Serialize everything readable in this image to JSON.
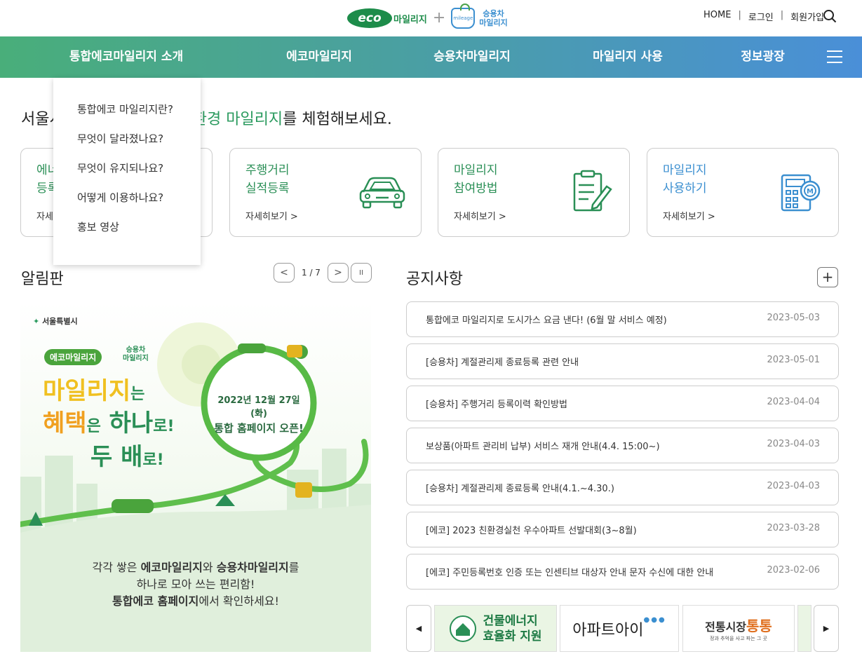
{
  "header": {
    "logo_eco": "eco",
    "logo_eco_suffix": "마일리지",
    "logo_plus": "+",
    "logo_bag_text": "mileage",
    "logo_car_line1": "승용차",
    "logo_car_line2": "마일리지",
    "links": [
      "HOME",
      "로그인",
      "회원가입"
    ],
    "separator": "|"
  },
  "nav": {
    "items": [
      "통합에코마일리지 소개",
      "에코마일리지",
      "승용차마일리지",
      "마일리지 사용",
      "정보광장"
    ]
  },
  "dropdown": {
    "items": [
      "통합에코 마일리지란?",
      "무엇이 달라졌나요?",
      "무엇이 유지되나요?",
      "어떻게 이용하나요?",
      "홍보 영상"
    ]
  },
  "headline": {
    "prefix": "서울시",
    "green": "환경 마일리지",
    "suffix": "를 체험해보세요."
  },
  "cards": [
    {
      "title": "에너지\n등록",
      "more": "자세히보기 >",
      "icon": "register-icon"
    },
    {
      "title": "주행거리\n실적등록",
      "more": "자세히보기 >",
      "icon": "car-icon"
    },
    {
      "title": "마일리지\n참여방법",
      "more": "자세히보기 >",
      "icon": "clipboard-icon"
    },
    {
      "title": "마일리지\n사용하기",
      "more": "자세히보기 >",
      "icon": "calculator-icon"
    }
  ],
  "board": {
    "title": "알림판",
    "page": "1 / 7",
    "prev": "<",
    "next": ">",
    "pause": "II"
  },
  "banner": {
    "city": "서울특별시",
    "eco_logo": "에코마일리지",
    "car_logo_line1": "승용차",
    "car_logo_line2": "마일리지",
    "line1a": "마일리지",
    "line1b": "는",
    "line2a": "혜택",
    "line2b": "은",
    "line2c": "하나",
    "line2d": "로!",
    "line3a": "두 배",
    "line3b": "로!",
    "date": "2022년 12월 27일(화)",
    "dash": "—",
    "open": "통합 홈페이지 오픈!",
    "bottom1a": "각각 쌓은 ",
    "bottom1b": "에코마일리지",
    "bottom1c": "와 ",
    "bottom1d": "승용차마일리지",
    "bottom1e": "를",
    "bottom2": "하나로 모아 쓰는 편리함!",
    "bottom3a": "통합에코 홈페이지",
    "bottom3b": "에서 확인하세요!"
  },
  "notices": {
    "title": "공지사항",
    "more": "+",
    "items": [
      {
        "title": "통합에코 마일리지로 도시가스 요금 낸다! (6월 말 서비스 예정)",
        "date": "2023-05-03"
      },
      {
        "title": "[승용차] 계절관리제 종료등록 관련 안내",
        "date": "2023-05-01"
      },
      {
        "title": "[승용차] 주행거리 등록이력 확인방법",
        "date": "2023-04-04"
      },
      {
        "title": "보상품(아파트 관리비 납부) 서비스 재개 안내(4.4. 15:00~)",
        "date": "2023-04-03"
      },
      {
        "title": "[승용차] 계절관리제 종료등록 안내(4.1.~4.30.)",
        "date": "2023-04-03"
      },
      {
        "title": "[에코] 2023 친환경실천 우수아파트 선발대회(3~8월)",
        "date": "2023-03-28"
      },
      {
        "title": "[에코] 주민등록번호 인증 또는 인센티브 대상자 안내 문자 수신에 대한 안내",
        "date": "2023-02-06"
      }
    ]
  },
  "partners": {
    "prev": "◀",
    "next": "▶",
    "items": [
      {
        "line1": "건물에너지",
        "line2": "효율화 지원"
      },
      {
        "line1": "아파트아이"
      },
      {
        "line1": "전통시장",
        "line2": "통통",
        "sub": "정과 추억을 사고 파는 그 곳"
      }
    ]
  },
  "colors": {
    "nav_start": "#49ae7a",
    "nav_end": "#4a8fd8",
    "green": "#2a9a5e",
    "blue": "#3b8fd0"
  }
}
